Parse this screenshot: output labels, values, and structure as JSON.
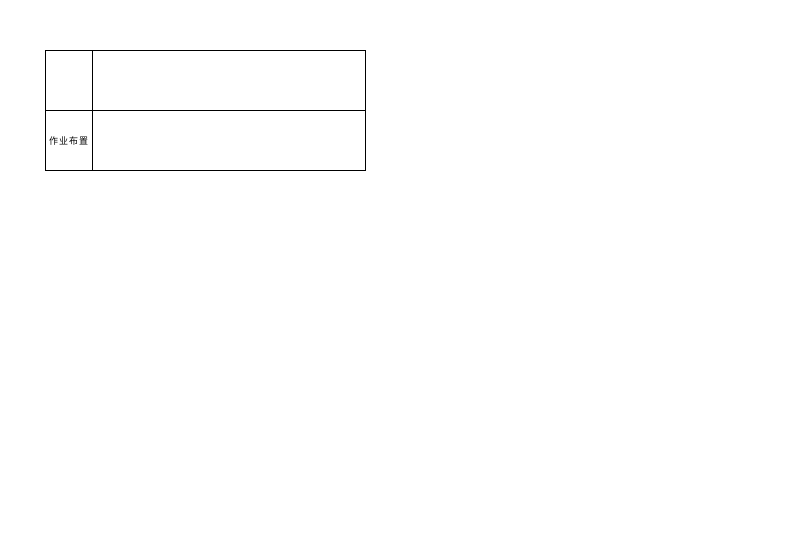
{
  "table": {
    "rows": [
      {
        "label": "",
        "content": ""
      },
      {
        "label": "作业布置",
        "content": ""
      }
    ]
  }
}
